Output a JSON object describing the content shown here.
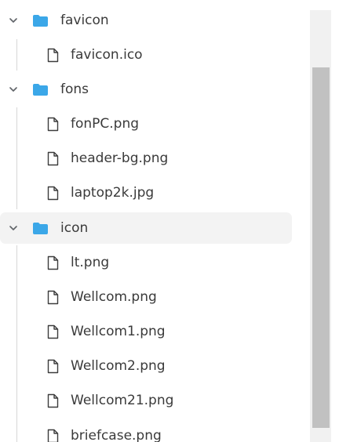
{
  "tree": [
    {
      "kind": "folder",
      "name": "favicon",
      "expanded": true,
      "children": [
        "favicon.ico"
      ]
    },
    {
      "kind": "folder",
      "name": "fons",
      "expanded": true,
      "children": [
        "fonPC.png",
        "header-bg.png",
        "laptop2k.jpg"
      ]
    },
    {
      "kind": "folder",
      "name": "icon",
      "expanded": true,
      "hovered": true,
      "children": [
        "lt.png",
        "Wellcom.png",
        "Wellcom1.png",
        "Wellcom2.png",
        "Wellcom21.png",
        "briefcase.png"
      ]
    }
  ],
  "icons": {
    "folder": "folder-icon",
    "file": "file-icon",
    "expanded": "chevron-down-icon"
  },
  "colors": {
    "folder": "#3ba7e8",
    "hover_bg": "#f3f3f3",
    "text": "#3a3a3a",
    "scrollbar_track": "#f1f1f1",
    "scrollbar_thumb": "#c1c1c1"
  }
}
